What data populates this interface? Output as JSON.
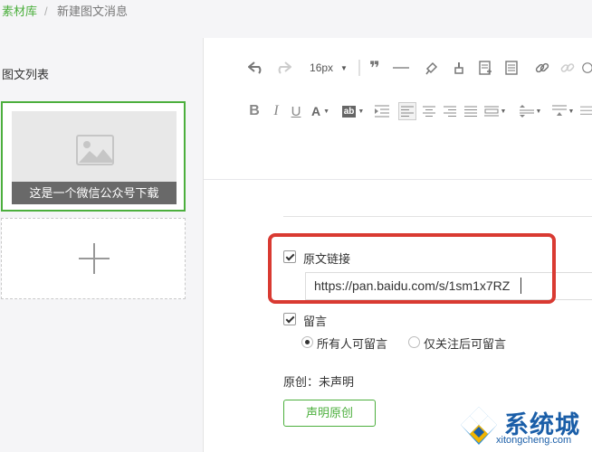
{
  "breadcrumb": {
    "parent": "素材库",
    "separator": "/",
    "current": "新建图文消息"
  },
  "sidebar": {
    "title": "图文列表",
    "articles": [
      {
        "caption": "这是一个微信公众号下载"
      }
    ],
    "add_icon": "plus-icon"
  },
  "toolbar": {
    "font_size": "16px",
    "row1_icons": [
      "undo-icon",
      "redo-icon",
      "font-size-dropdown",
      "blockquote-icon",
      "horizontal-rule-icon",
      "format-brush-icon",
      "clear-format-icon",
      "insert-template-icon",
      "paste-text-icon",
      "link-icon",
      "unlink-icon",
      "emoji-icon"
    ],
    "row2_icons": [
      "bold-icon",
      "italic-icon",
      "underline-icon",
      "font-color-icon",
      "background-color-icon",
      "indent-icon",
      "align-left-icon",
      "align-center-icon",
      "align-right-icon",
      "justify-icon",
      "list-icon",
      "line-height-icon",
      "paragraph-spacing-icon"
    ]
  },
  "settings": {
    "original_link": {
      "label": "原文链接",
      "checked": true,
      "value": "https://pan.baidu.com/s/1sm1x7RZ"
    },
    "comment": {
      "label": "留言",
      "checked": true,
      "options": [
        {
          "label": "所有人可留言",
          "selected": true
        },
        {
          "label": "仅关注后可留言",
          "selected": false
        }
      ]
    },
    "original_status": "原创：未声明",
    "declare_button": "声明原创"
  },
  "watermark": {
    "brand": "系统城",
    "domain": "xitongcheng.com"
  },
  "colors": {
    "accent": "#4caf3d",
    "highlight": "#d93a32",
    "watermark": "#1a5ea8"
  }
}
